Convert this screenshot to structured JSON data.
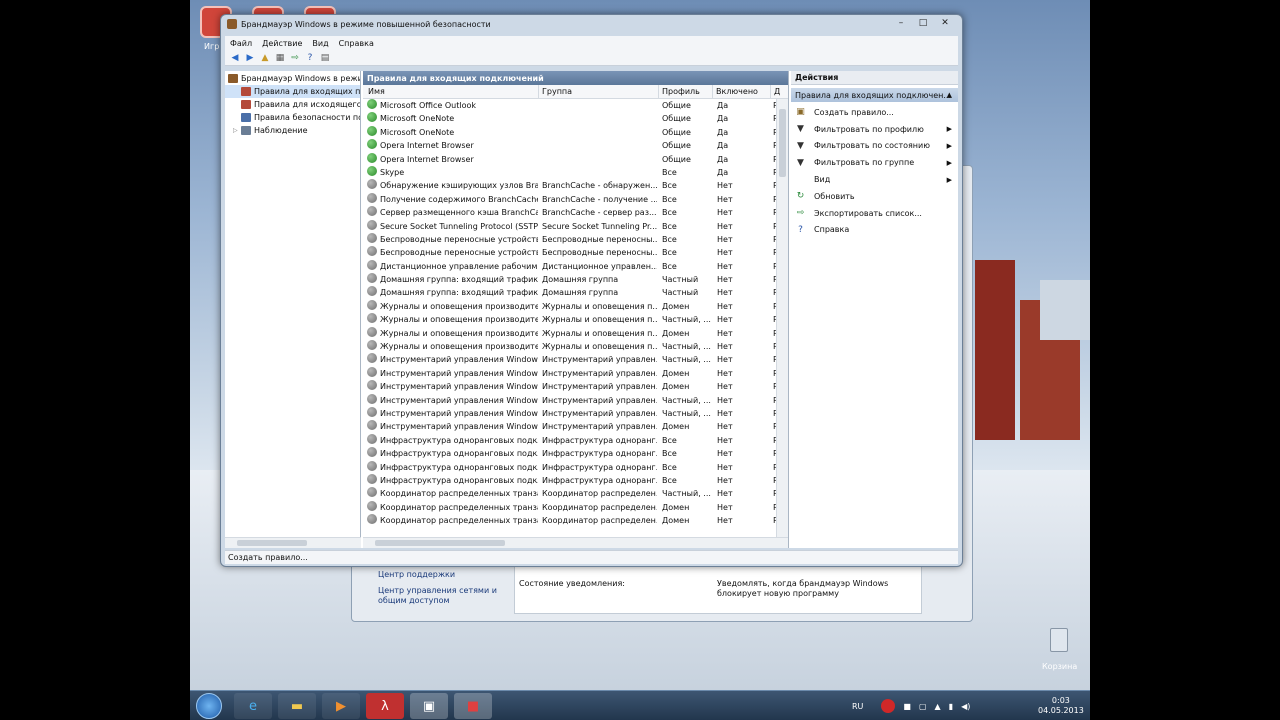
{
  "window": {
    "title": "Брандмауэр Windows в режиме повышенной безопасности"
  },
  "menu": [
    "Файл",
    "Действие",
    "Вид",
    "Справка"
  ],
  "tree": [
    {
      "label": "Брандмауэр Windows в режим",
      "color": "#8a5a2a"
    },
    {
      "label": "Правила для входящих под",
      "color": "#b44a3a"
    },
    {
      "label": "Правила для исходящего т",
      "color": "#b44a3a"
    },
    {
      "label": "Правила безопасности по,",
      "color": "#4a6fa8"
    },
    {
      "label": "Наблюдение",
      "color": "#6a7d95"
    }
  ],
  "center": {
    "title": "Правила для входящих подключений",
    "columns": [
      "Имя",
      "Группа",
      "Профиль",
      "Включено",
      "Д"
    ],
    "rows": [
      {
        "name": "Microsoft Office Outlook",
        "group": "",
        "profile": "Общие",
        "enabled": "Да",
        "extra": "Р",
        "on": true
      },
      {
        "name": "Microsoft OneNote",
        "group": "",
        "profile": "Общие",
        "enabled": "Да",
        "extra": "Р",
        "on": true
      },
      {
        "name": "Microsoft OneNote",
        "group": "",
        "profile": "Общие",
        "enabled": "Да",
        "extra": "Р",
        "on": true
      },
      {
        "name": "Opera Internet Browser",
        "group": "",
        "profile": "Общие",
        "enabled": "Да",
        "extra": "Р",
        "on": true
      },
      {
        "name": "Opera Internet Browser",
        "group": "",
        "profile": "Общие",
        "enabled": "Да",
        "extra": "Р",
        "on": true
      },
      {
        "name": "Skype",
        "group": "",
        "profile": "Все",
        "enabled": "Да",
        "extra": "Р",
        "on": true
      },
      {
        "name": "Обнаружение кэширующих узлов Bran...",
        "group": "BranchCache - обнаружен...",
        "profile": "Все",
        "enabled": "Нет",
        "extra": "Р",
        "on": false
      },
      {
        "name": "Получение содержимого BranchCache ...",
        "group": "BranchCache - получение ...",
        "profile": "Все",
        "enabled": "Нет",
        "extra": "Р",
        "on": false
      },
      {
        "name": "Сервер размещенного кэша BranchCa...",
        "group": "BranchCache - сервер раз...",
        "profile": "Все",
        "enabled": "Нет",
        "extra": "Р",
        "on": false
      },
      {
        "name": "Secure Socket Tunneling Protocol (SSTP-...",
        "group": "Secure Socket Tunneling Pr...",
        "profile": "Все",
        "enabled": "Нет",
        "extra": "Р",
        "on": false
      },
      {
        "name": "Беспроводные переносные устройства...",
        "group": "Беспроводные переносны...",
        "profile": "Все",
        "enabled": "Нет",
        "extra": "Р",
        "on": false
      },
      {
        "name": "Беспроводные переносные устройства...",
        "group": "Беспроводные переносны...",
        "profile": "Все",
        "enabled": "Нет",
        "extra": "Р",
        "on": false
      },
      {
        "name": "Дистанционное управление рабочим с...",
        "group": "Дистанционное управлен...",
        "profile": "Все",
        "enabled": "Нет",
        "extra": "Р",
        "on": false
      },
      {
        "name": "Домашняя группа: входящий трафик",
        "group": "Домашняя группа",
        "profile": "Частный",
        "enabled": "Нет",
        "extra": "Р",
        "on": false
      },
      {
        "name": "Домашняя группа: входящий трафик (...",
        "group": "Домашняя группа",
        "profile": "Частный",
        "enabled": "Нет",
        "extra": "Р",
        "on": false
      },
      {
        "name": "Журналы и оповещения производител...",
        "group": "Журналы и оповещения п...",
        "profile": "Домен",
        "enabled": "Нет",
        "extra": "Р",
        "on": false
      },
      {
        "name": "Журналы и оповещения производител...",
        "group": "Журналы и оповещения п...",
        "profile": "Частный, ...",
        "enabled": "Нет",
        "extra": "Р",
        "on": false
      },
      {
        "name": "Журналы и оповещения производител...",
        "group": "Журналы и оповещения п...",
        "profile": "Домен",
        "enabled": "Нет",
        "extra": "Р",
        "on": false
      },
      {
        "name": "Журналы и оповещения производител...",
        "group": "Журналы и оповещения п...",
        "profile": "Частный, ...",
        "enabled": "Нет",
        "extra": "Р",
        "on": false
      },
      {
        "name": "Инструментарий управления Windows ...",
        "group": "Инструментарий управлен...",
        "profile": "Частный, ...",
        "enabled": "Нет",
        "extra": "Р",
        "on": false
      },
      {
        "name": "Инструментарий управления Windows ...",
        "group": "Инструментарий управлен...",
        "profile": "Домен",
        "enabled": "Нет",
        "extra": "Р",
        "on": false
      },
      {
        "name": "Инструментарий управления Windows ...",
        "group": "Инструментарий управлен...",
        "profile": "Домен",
        "enabled": "Нет",
        "extra": "Р",
        "on": false
      },
      {
        "name": "Инструментарий управления Windows ...",
        "group": "Инструментарий управлен...",
        "profile": "Частный, ...",
        "enabled": "Нет",
        "extra": "Р",
        "on": false
      },
      {
        "name": "Инструментарий управления Windows ...",
        "group": "Инструментарий управлен...",
        "profile": "Частный, ...",
        "enabled": "Нет",
        "extra": "Р",
        "on": false
      },
      {
        "name": "Инструментарий управления Windows ...",
        "group": "Инструментарий управлен...",
        "profile": "Домен",
        "enabled": "Нет",
        "extra": "Р",
        "on": false
      },
      {
        "name": "Инфраструктура одноранговых подкл...",
        "group": "Инфраструктура одноранг...",
        "profile": "Все",
        "enabled": "Нет",
        "extra": "Р",
        "on": false
      },
      {
        "name": "Инфраструктура одноранговых подкл...",
        "group": "Инфраструктура одноранг...",
        "profile": "Все",
        "enabled": "Нет",
        "extra": "Р",
        "on": false
      },
      {
        "name": "Инфраструктура одноранговых подкл...",
        "group": "Инфраструктура одноранг...",
        "profile": "Все",
        "enabled": "Нет",
        "extra": "Р",
        "on": false
      },
      {
        "name": "Инфраструктура одноранговых подкл...",
        "group": "Инфраструктура одноранг...",
        "profile": "Все",
        "enabled": "Нет",
        "extra": "Р",
        "on": false
      },
      {
        "name": "Координатор распределенных транзак...",
        "group": "Координатор распределен...",
        "profile": "Частный, ...",
        "enabled": "Нет",
        "extra": "Р",
        "on": false
      },
      {
        "name": "Координатор распределенных транзак...",
        "group": "Координатор распределен...",
        "profile": "Домен",
        "enabled": "Нет",
        "extra": "Р",
        "on": false
      },
      {
        "name": "Координатор распределенных транзак...",
        "group": "Координатор распределен...",
        "profile": "Домен",
        "enabled": "Нет",
        "extra": "Р",
        "on": false
      }
    ]
  },
  "actions": {
    "title": "Действия",
    "subtitle": "Правила для входящих подключен...",
    "items": [
      {
        "label": "Создать правило...",
        "icon": "new-rule-icon",
        "glyph": "▣",
        "color": "#8a6a2a",
        "sub": false
      },
      {
        "label": "Фильтровать по профилю",
        "icon": "filter-icon",
        "glyph": "▼",
        "color": "#333",
        "sub": true
      },
      {
        "label": "Фильтровать по состоянию",
        "icon": "filter-icon",
        "glyph": "▼",
        "color": "#333",
        "sub": true
      },
      {
        "label": "Фильтровать по группе",
        "icon": "filter-icon",
        "glyph": "▼",
        "color": "#333",
        "sub": true
      },
      {
        "label": "Вид",
        "icon": "view-icon",
        "glyph": "",
        "color": "#333",
        "sub": true
      },
      {
        "label": "Обновить",
        "icon": "refresh-icon",
        "glyph": "↻",
        "color": "#2a8a3a",
        "sub": false
      },
      {
        "label": "Экспортировать список...",
        "icon": "export-icon",
        "glyph": "⇨",
        "color": "#2a8a3a",
        "sub": false
      },
      {
        "label": "Справка",
        "icon": "help-icon",
        "glyph": "?",
        "color": "#2a55a8",
        "sub": false
      }
    ]
  },
  "status": "Создать правило...",
  "background_window": {
    "links": [
      "Центр поддержки",
      "Центр управления сетями и общим доступом"
    ],
    "notify_label": "Состояние уведомления:",
    "notify_value": "Уведомлять, когда брандмауэр Windows блокирует новую программу"
  },
  "desktop": {
    "recycle_label": "Корзина",
    "partial_label": "Игр"
  },
  "tray": {
    "lang": "RU",
    "time": "0:03",
    "date": "04.05.2013"
  }
}
